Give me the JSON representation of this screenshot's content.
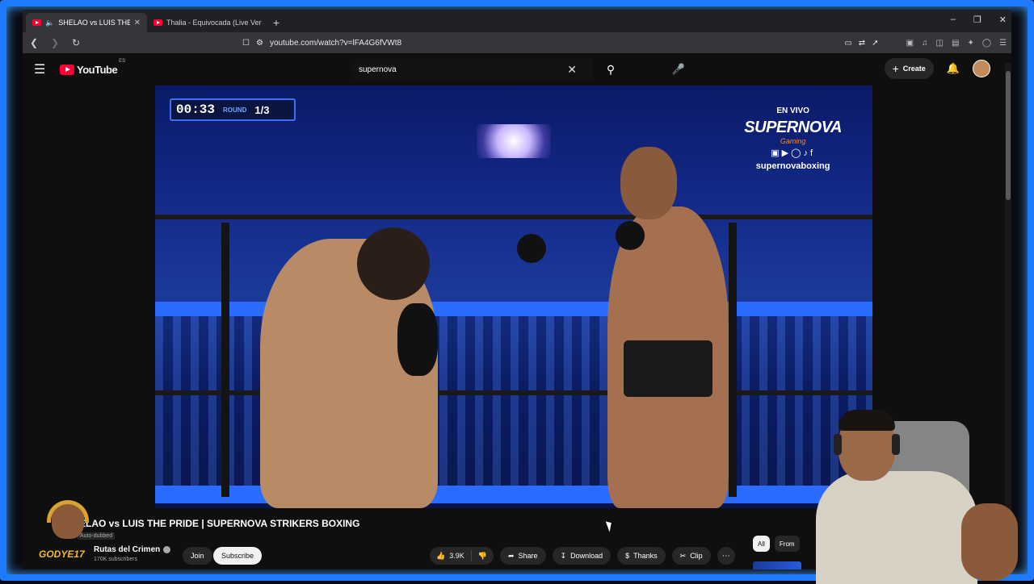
{
  "browser": {
    "tabs": [
      {
        "title": "SHELAO vs LUIS THE PRIDE | S",
        "active": true,
        "audio": true
      },
      {
        "title": "Thalia - Equivocada (Live Version) - Y",
        "active": false,
        "audio": false
      }
    ],
    "url": "youtube.com/watch?v=lFA4G6fVWt8"
  },
  "youtube": {
    "logo_text": "YouTube",
    "country_code": "ES",
    "search_value": "supernova",
    "create_label": "Create"
  },
  "overlay": {
    "timer": "00:33",
    "round_label": "ROUND",
    "round_value": "1/3",
    "brand_live": "EN VIVO",
    "brand_name": "SUPERNOVA",
    "brand_sub": "Gaming",
    "brand_handle": "supernovaboxing"
  },
  "video": {
    "title": "ELAO vs LUIS THE PRIDE | SUPERNOVA STRIKERS BOXING",
    "auto_dubbed": "Auto-dubbed",
    "channel_name": "Rutas del Crimen",
    "subscribers": "170K subscribers",
    "join_label": "Join",
    "subscribe_label": "Subscribe",
    "likes": "3.9K",
    "share_label": "Share",
    "download_label": "Download",
    "thanks_label": "Thanks",
    "clip_label": "Clip"
  },
  "sidebar_chips": [
    {
      "label": "All",
      "active": true
    },
    {
      "label": "From",
      "active": false
    }
  ],
  "streamer": {
    "tag": "GODYE17"
  },
  "colors": {
    "frame": "#1e7bff",
    "youtube_red": "#ff0033",
    "subscribe_bg": "#f1f1f1"
  }
}
